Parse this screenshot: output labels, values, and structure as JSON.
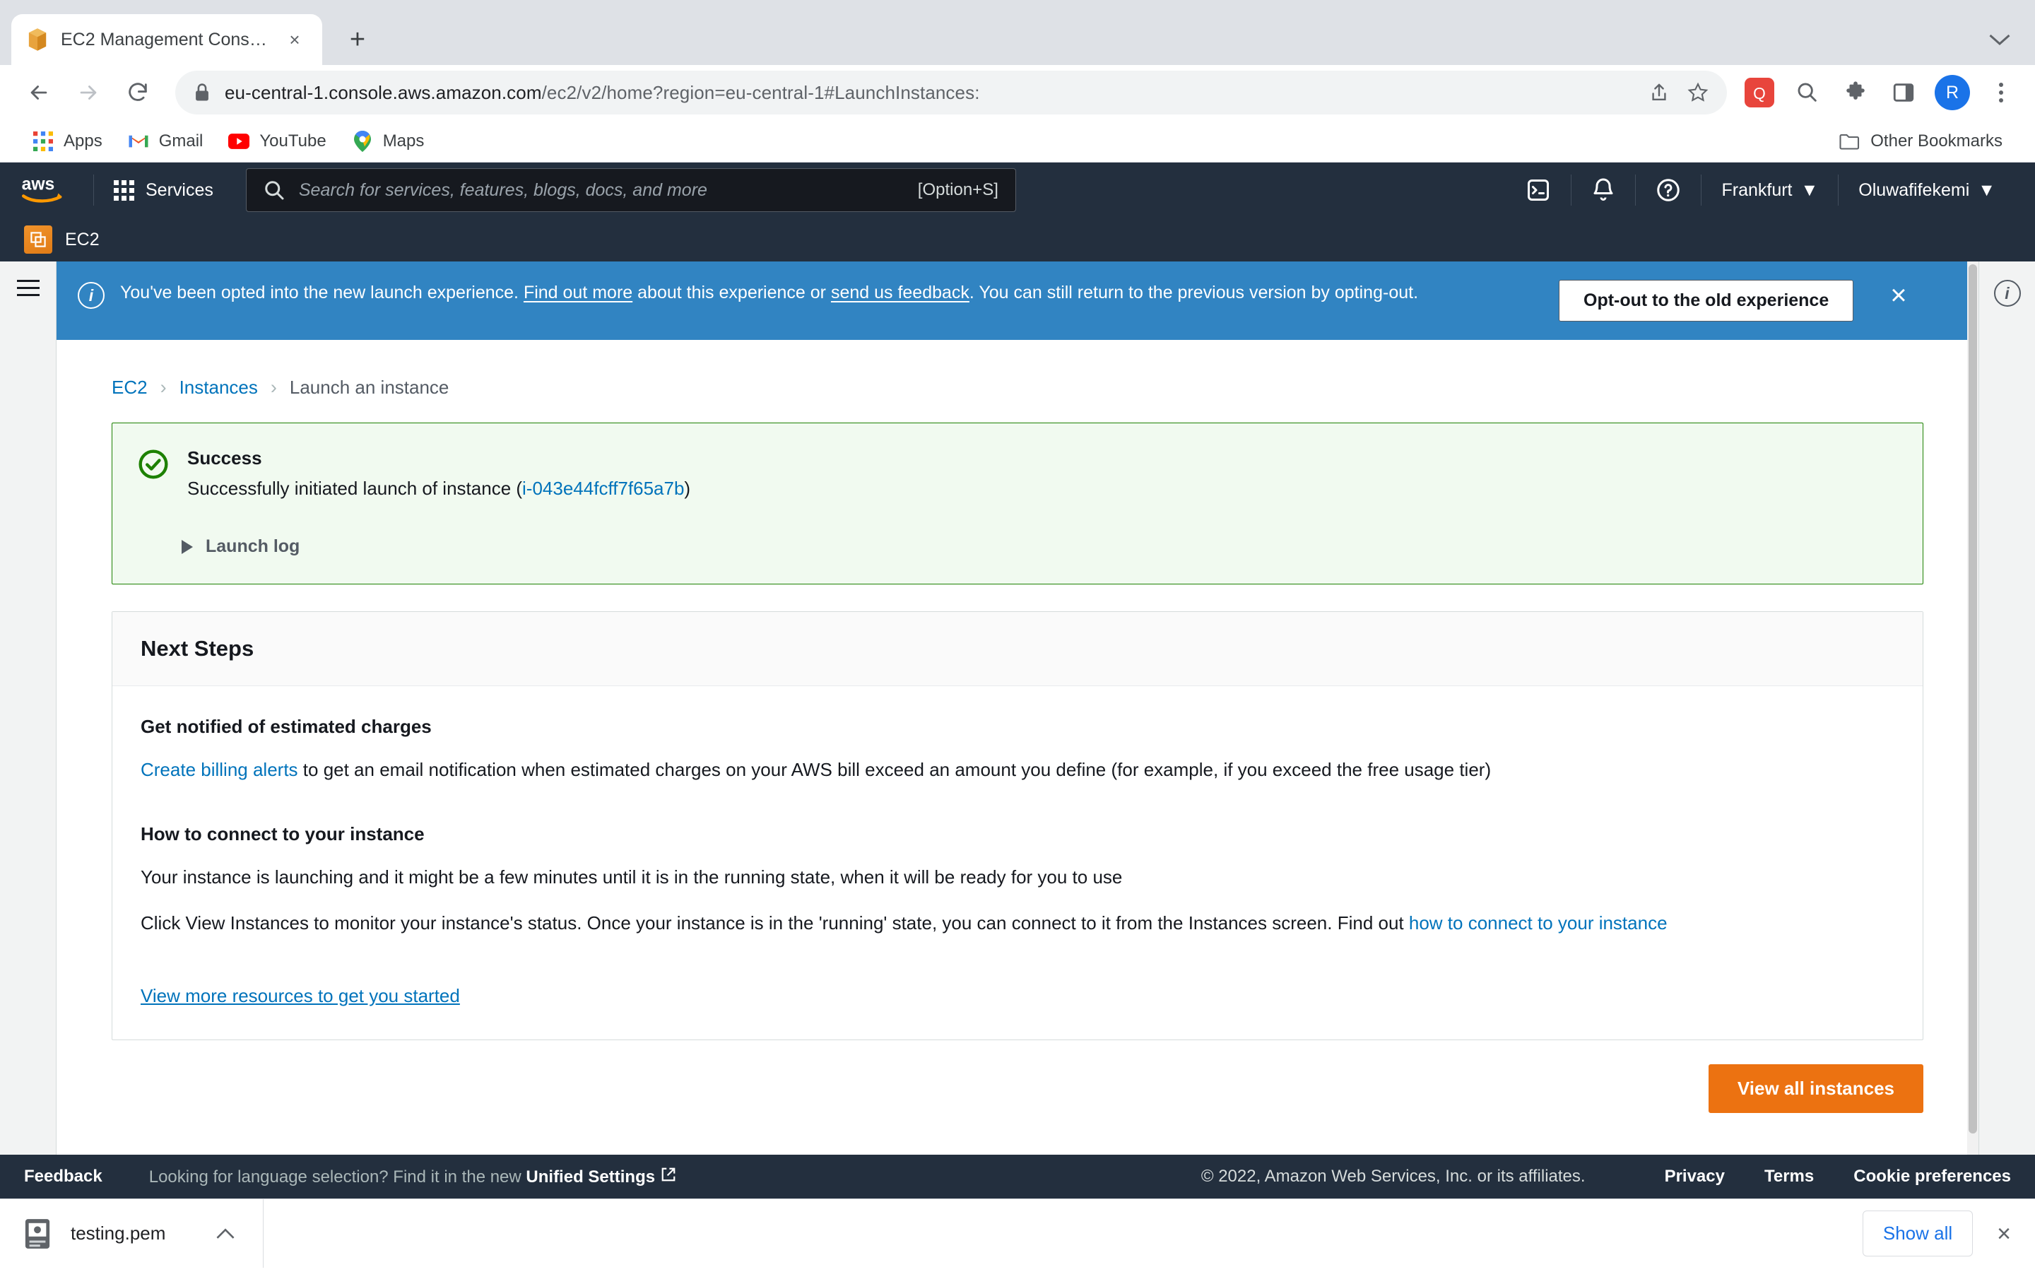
{
  "browser": {
    "tab": {
      "title": "EC2 Management Console",
      "favicon": "aws-cube-icon",
      "close": "×"
    },
    "new_tab_label": "+",
    "url": {
      "domain": "eu-central-1.console.aws.amazon.com",
      "path": "/ec2/v2/home?region=eu-central-1#LaunchInstances:"
    },
    "nav": {
      "back": "back-arrow-icon",
      "forward": "forward-arrow-icon",
      "reload": "reload-icon"
    },
    "bookmarks": [
      {
        "label": "Apps",
        "icon": "apps-grid-icon"
      },
      {
        "label": "Gmail",
        "icon": "gmail-icon"
      },
      {
        "label": "YouTube",
        "icon": "youtube-icon"
      },
      {
        "label": "Maps",
        "icon": "maps-pin-icon"
      }
    ],
    "other_bookmarks": "Other Bookmarks",
    "profile_initial": "R"
  },
  "aws_header": {
    "logo": "aws-logo",
    "services_label": "Services",
    "search_placeholder": "Search for services, features, blogs, docs, and more",
    "search_value": "",
    "search_shortcut": "[Option+S]",
    "region": "Frankfurt",
    "account": "Oluwafifekemi",
    "icons": [
      "cloudshell-icon",
      "bell-icon",
      "help-icon"
    ]
  },
  "service_bar": {
    "name": "EC2",
    "icon": "ec2-icon"
  },
  "notification": {
    "icon": "info-icon",
    "text_part1": "You've been opted into the new launch experience. ",
    "link1": "Find out more",
    "text_part2": " about this experience or ",
    "link2": "send us feedback",
    "text_part3": ". You can still return to the previous version by opting-out.",
    "optout_button": "Opt-out to the old experience",
    "close": "×"
  },
  "breadcrumb": [
    {
      "label": "EC2",
      "link": true
    },
    {
      "label": "Instances",
      "link": true
    },
    {
      "label": "Launch an instance",
      "link": false
    }
  ],
  "alert": {
    "icon": "success-check-icon",
    "title": "Success",
    "message_prefix": "Successfully initiated launch of instance (",
    "instance_id": "i-043e44fcff7f65a7b",
    "message_suffix": ")",
    "launch_log_label": "Launch log",
    "accent_color": "#1d8102",
    "background_color": "#f1faf0"
  },
  "next_steps": {
    "heading": "Next Steps",
    "billing": {
      "title": "Get notified of estimated charges",
      "link": "Create billing alerts",
      "body": " to get an email notification when estimated charges on your AWS bill exceed an amount you define (for example, if you exceed the free usage tier)"
    },
    "connect": {
      "title": "How to connect to your instance",
      "para1": "Your instance is launching and it might be a few minutes until it is in the running state, when it will be ready for you to use",
      "para2_prefix": "Click View Instances to monitor your instance's status. Once your instance is in the 'running' state, you can connect to it from the Instances screen. Find out ",
      "para2_link": "how to connect to your instance"
    },
    "more_resources_link": "View more resources to get you started"
  },
  "primary_button": {
    "label": "View all instances",
    "color": "#ec7211"
  },
  "footer": {
    "feedback": "Feedback",
    "language_hint_prefix": "Looking for language selection? Find it in the new ",
    "language_hint_bold": "Unified Settings",
    "copyright": "© 2022, Amazon Web Services, Inc. or its affiliates.",
    "links": [
      "Privacy",
      "Terms",
      "Cookie preferences"
    ]
  },
  "downloads": {
    "file_name": "testing.pem",
    "file_icon": "certificate-file-icon",
    "caret": "chevron-up-icon",
    "show_all": "Show all",
    "close": "×"
  }
}
